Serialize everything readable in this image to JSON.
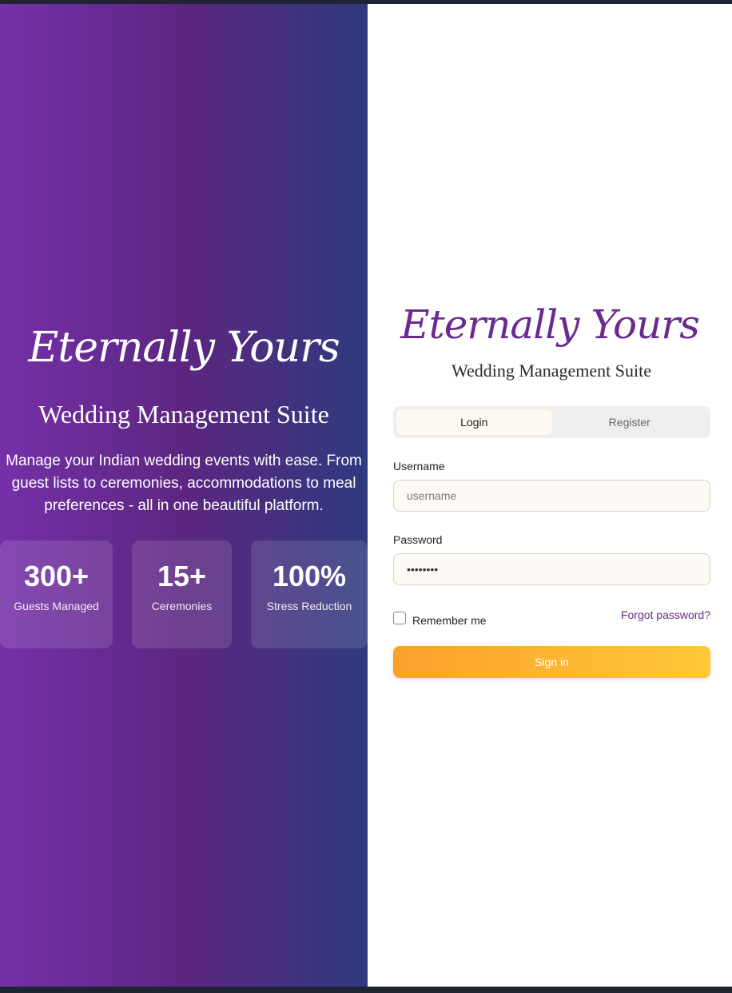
{
  "hero": {
    "brand": "Eternally Yours",
    "subtitle": "Wedding Management Suite",
    "description": "Manage your Indian wedding events with ease. From guest lists to ceremonies, accommodations to meal preferences - all in one beautiful platform.",
    "stats": [
      {
        "value": "300+",
        "label": "Guests Managed"
      },
      {
        "value": "15+",
        "label": "Ceremonies"
      },
      {
        "value": "100%",
        "label": "Stress Reduction"
      }
    ]
  },
  "panel": {
    "brand": "Eternally Yours",
    "subtitle": "Wedding Management Suite",
    "tabs": [
      {
        "label": "Login",
        "active": true
      },
      {
        "label": "Register",
        "active": false
      }
    ],
    "username": {
      "label": "Username",
      "placeholder": "username",
      "value": ""
    },
    "password": {
      "label": "Password",
      "value": "password"
    },
    "remember_label": "Remember me",
    "forgot_label": "Forgot password?",
    "signin_label": "Sign in"
  },
  "colors": {
    "brand_purple": "#6b2a8f",
    "accent_orange": "#fca12a",
    "accent_yellow": "#ffc83a"
  }
}
